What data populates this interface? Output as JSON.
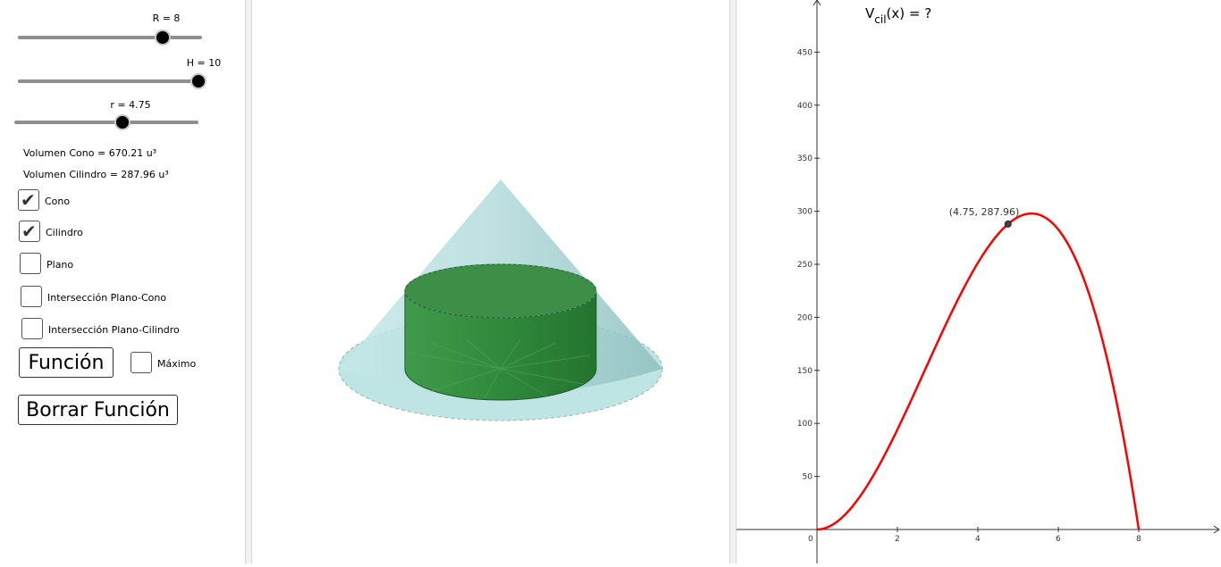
{
  "sliders": [
    {
      "label": "R = 8",
      "value": 8,
      "min": 0,
      "max": 10
    },
    {
      "label": "H = 10",
      "value": 10,
      "min": 0,
      "max": 10
    },
    {
      "label": "r = 4.75",
      "value": 4.75,
      "min": 0,
      "max": 6
    }
  ],
  "volumes": {
    "cone": "Volumen Cono = 670.21  u³",
    "cylinder": "Volumen Cilindro = 287.96  u³"
  },
  "checkboxes": [
    {
      "label": "Cono",
      "checked": true
    },
    {
      "label": "Cilindro",
      "checked": true
    },
    {
      "label": "Plano",
      "checked": false
    },
    {
      "label": "Intersección Plano-Cono",
      "checked": false
    },
    {
      "label": "Intersección Plano-Cilindro",
      "checked": false
    }
  ],
  "buttons": {
    "funcion": "Función",
    "borrar": "Borrar Función"
  },
  "maximo": {
    "label": "Máximo",
    "checked": false
  },
  "graph": {
    "title_main": "V",
    "title_sub": "cil",
    "title_rest": "(x)  =  ?",
    "point_label": "(4.75, 287.96)",
    "origin_label": "0",
    "x_ticks": [
      "2",
      "4",
      "6",
      "8"
    ],
    "y_ticks": [
      "50",
      "100",
      "150",
      "200",
      "250",
      "300",
      "350",
      "400",
      "450"
    ],
    "curve_color": "#ff0000"
  },
  "chart_data": {
    "type": "line",
    "title": "",
    "function": "V(x) = pi * x^2 * (10 - 10*x/8)",
    "x_range": [
      0,
      8
    ],
    "xlim": [
      -2,
      10
    ],
    "ylim": [
      -5,
      500
    ],
    "point": {
      "x": 4.75,
      "y": 287.96
    },
    "x_ticks": [
      2,
      4,
      6,
      8
    ],
    "y_ticks": [
      50,
      100,
      150,
      200,
      250,
      300,
      350,
      400,
      450
    ]
  },
  "colors": {
    "cone": "#9fd3d3",
    "cylinder": "#2e8b3a",
    "curve": "#ff0000"
  }
}
